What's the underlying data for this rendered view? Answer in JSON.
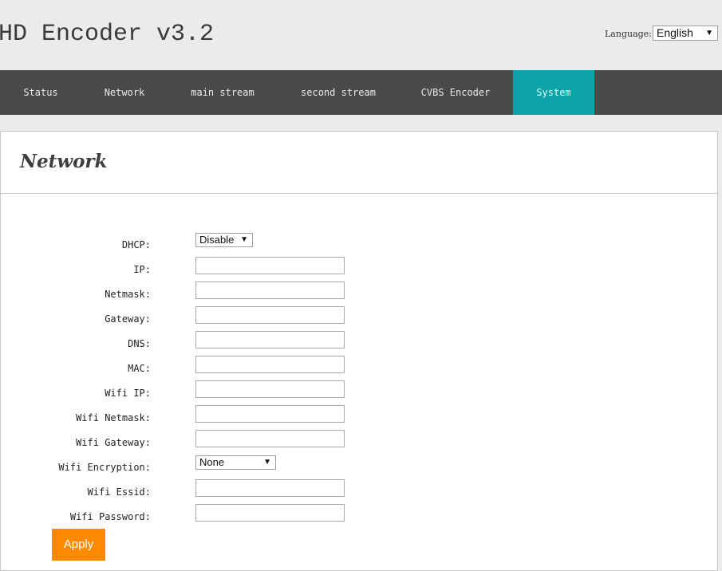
{
  "header": {
    "title": "HD Encoder v3.2",
    "language_label": "Language:",
    "language_value": "English"
  },
  "nav": {
    "items": [
      {
        "label": "Status"
      },
      {
        "label": "Network"
      },
      {
        "label": "main stream"
      },
      {
        "label": "second stream"
      },
      {
        "label": "CVBS Encoder"
      },
      {
        "label": "System"
      }
    ],
    "active": "System",
    "active_color": "#0ca3a8"
  },
  "panel": {
    "title": "Network"
  },
  "form": {
    "dhcp": {
      "label": "DHCP:",
      "value": "Disable"
    },
    "ip": {
      "label": "IP:",
      "value": ""
    },
    "netmask": {
      "label": "Netmask:",
      "value": ""
    },
    "gateway": {
      "label": "Gateway:",
      "value": ""
    },
    "dns": {
      "label": "DNS:",
      "value": ""
    },
    "mac": {
      "label": "MAC:",
      "value": ""
    },
    "wifi_ip": {
      "label": "Wifi IP:",
      "value": ""
    },
    "wifi_netmask": {
      "label": "Wifi Netmask:",
      "value": ""
    },
    "wifi_gateway": {
      "label": "Wifi Gateway:",
      "value": ""
    },
    "wifi_encryption": {
      "label": "Wifi Encryption:",
      "value": "None"
    },
    "wifi_essid": {
      "label": "Wifi Essid:",
      "value": ""
    },
    "wifi_password": {
      "label": "Wifi Password:",
      "value": ""
    },
    "apply_label": "Apply",
    "apply_color": "#ff8a00"
  }
}
